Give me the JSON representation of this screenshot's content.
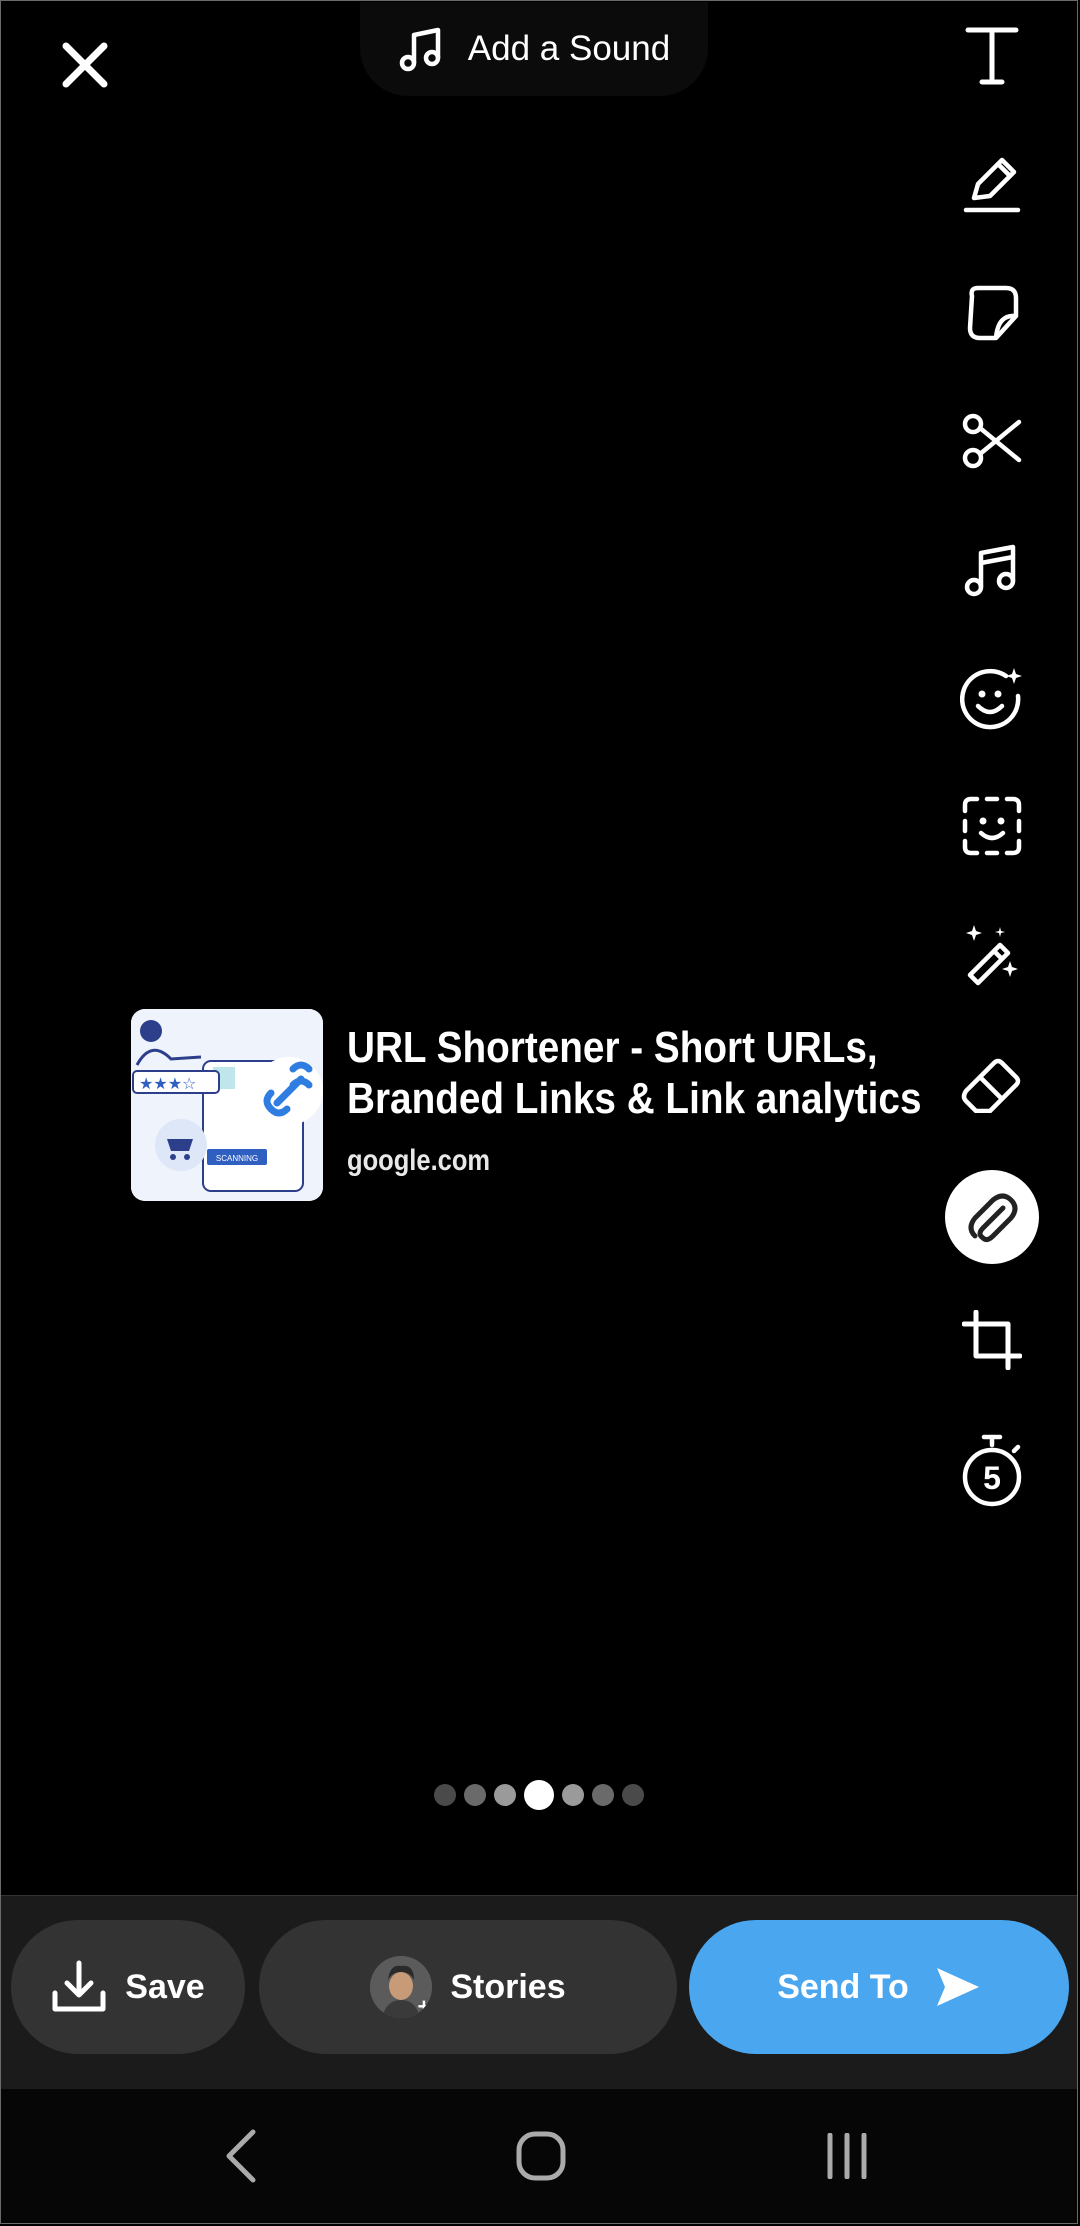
{
  "top": {
    "add_sound_label": "Add a Sound"
  },
  "toolbar": {
    "tools": [
      {
        "name": "text-tool",
        "icon": "text-icon"
      },
      {
        "name": "draw-tool",
        "icon": "pencil-icon"
      },
      {
        "name": "sticker-tool",
        "icon": "sticker-icon"
      },
      {
        "name": "scissors-tool",
        "icon": "scissors-icon"
      },
      {
        "name": "music-tool",
        "icon": "music-note-icon"
      },
      {
        "name": "lens-tool",
        "icon": "smiley-sparkle-icon"
      },
      {
        "name": "scan-tool",
        "icon": "face-scan-icon"
      },
      {
        "name": "magic-tool",
        "icon": "magic-wand-icon"
      },
      {
        "name": "eraser-tool",
        "icon": "eraser-icon"
      },
      {
        "name": "link-tool",
        "icon": "paperclip-icon",
        "active": true
      },
      {
        "name": "crop-tool",
        "icon": "crop-icon"
      },
      {
        "name": "timer-tool",
        "icon": "timer-icon",
        "timer_value": "5"
      }
    ]
  },
  "link_card": {
    "title_line1": "URL Shortener - Short URLs,",
    "title_line2": "Branded Links & Link analytics",
    "domain": "google.com",
    "thumbnail_badge": "SCANNING"
  },
  "pager": {
    "count": 7,
    "active_index": 3
  },
  "actions": {
    "save_label": "Save",
    "stories_label": "Stories",
    "send_label": "Send To"
  },
  "colors": {
    "background": "#000000",
    "send_button": "#4aa6ef",
    "secondary_button": "#333333"
  }
}
